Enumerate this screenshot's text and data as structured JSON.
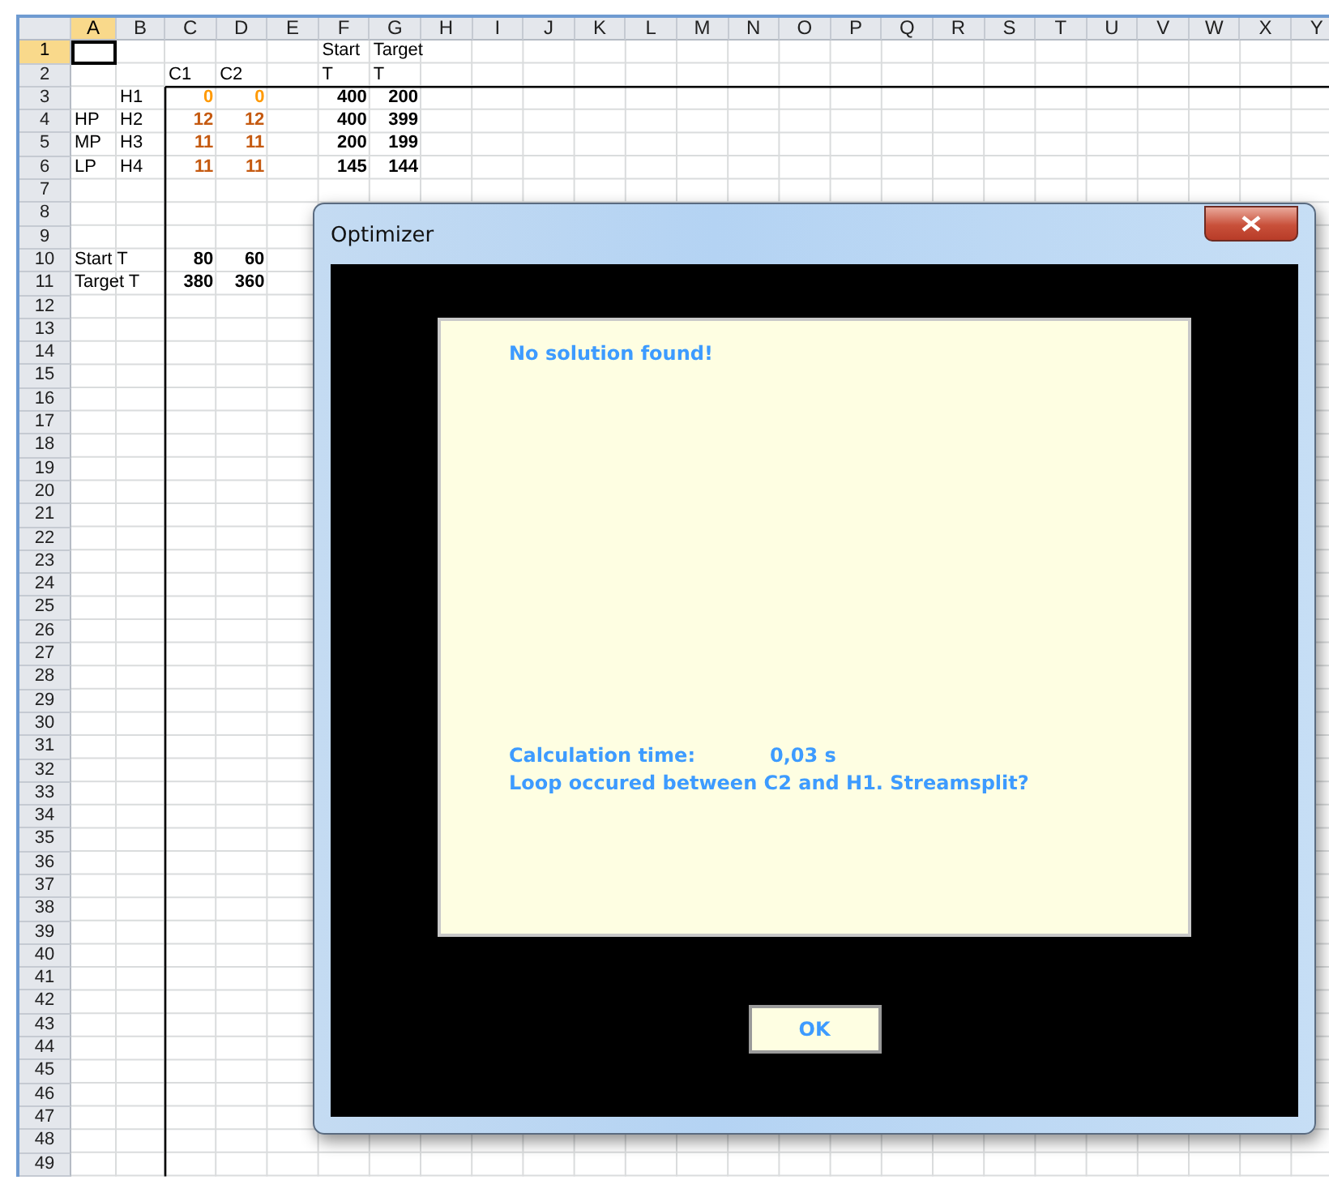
{
  "sheet": {
    "columns": [
      {
        "label": "A",
        "selected": true
      },
      {
        "label": "B",
        "selected": false
      },
      {
        "label": "C",
        "selected": false
      },
      {
        "label": "D",
        "selected": false
      },
      {
        "label": "E",
        "selected": false
      },
      {
        "label": "F",
        "selected": false
      },
      {
        "label": "G",
        "selected": false
      },
      {
        "label": "H",
        "selected": false
      },
      {
        "label": "I",
        "selected": false
      },
      {
        "label": "J",
        "selected": false
      },
      {
        "label": "K",
        "selected": false
      },
      {
        "label": "L",
        "selected": false
      },
      {
        "label": "M",
        "selected": false
      },
      {
        "label": "N",
        "selected": false
      },
      {
        "label": "O",
        "selected": false
      },
      {
        "label": "P",
        "selected": false
      },
      {
        "label": "Q",
        "selected": false
      },
      {
        "label": "R",
        "selected": false
      },
      {
        "label": "S",
        "selected": false
      },
      {
        "label": "T",
        "selected": false
      },
      {
        "label": "U",
        "selected": false
      },
      {
        "label": "V",
        "selected": false
      },
      {
        "label": "W",
        "selected": false
      },
      {
        "label": "X",
        "selected": false
      },
      {
        "label": "Y",
        "selected": false
      }
    ],
    "rows": [
      {
        "label": "1",
        "selected": true,
        "cells": [
          null,
          null,
          null,
          null,
          null,
          {
            "kind": "text",
            "text": "Start"
          },
          {
            "kind": "text",
            "text": "Target"
          }
        ]
      },
      {
        "label": "2",
        "selected": false,
        "cells": [
          null,
          null,
          {
            "kind": "text",
            "text": "C1"
          },
          {
            "kind": "text",
            "text": "C2"
          },
          null,
          {
            "kind": "text",
            "text": "T"
          },
          {
            "kind": "text",
            "text": "T"
          }
        ]
      },
      {
        "label": "3",
        "selected": false,
        "cells": [
          null,
          {
            "kind": "text",
            "text": "H1"
          },
          {
            "kind": "number",
            "text": "0",
            "color": "#ff9900"
          },
          {
            "kind": "number",
            "text": "0",
            "color": "#ff9900"
          },
          null,
          {
            "kind": "number",
            "text": "400",
            "color": "#000000"
          },
          {
            "kind": "number",
            "text": "200",
            "color": "#000000"
          }
        ]
      },
      {
        "label": "4",
        "selected": false,
        "cells": [
          {
            "kind": "text",
            "text": "HP"
          },
          {
            "kind": "text",
            "text": "H2"
          },
          {
            "kind": "number",
            "text": "12",
            "color": "#c55a11"
          },
          {
            "kind": "number",
            "text": "12",
            "color": "#c55a11"
          },
          null,
          {
            "kind": "number",
            "text": "400",
            "color": "#000000"
          },
          {
            "kind": "number",
            "text": "399",
            "color": "#000000"
          }
        ]
      },
      {
        "label": "5",
        "selected": false,
        "cells": [
          {
            "kind": "text",
            "text": "MP"
          },
          {
            "kind": "text",
            "text": "H3"
          },
          {
            "kind": "number",
            "text": "11",
            "color": "#c55a11"
          },
          {
            "kind": "number",
            "text": "11",
            "color": "#c55a11"
          },
          null,
          {
            "kind": "number",
            "text": "200",
            "color": "#000000"
          },
          {
            "kind": "number",
            "text": "199",
            "color": "#000000"
          }
        ]
      },
      {
        "label": "6",
        "selected": false,
        "cells": [
          {
            "kind": "text",
            "text": "LP"
          },
          {
            "kind": "text",
            "text": "H4"
          },
          {
            "kind": "number",
            "text": "11",
            "color": "#c55a11"
          },
          {
            "kind": "number",
            "text": "11",
            "color": "#c55a11"
          },
          null,
          {
            "kind": "number",
            "text": "145",
            "color": "#000000"
          },
          {
            "kind": "number",
            "text": "144",
            "color": "#000000"
          }
        ]
      },
      {
        "label": "7",
        "selected": false
      },
      {
        "label": "8",
        "selected": false
      },
      {
        "label": "9",
        "selected": false
      },
      {
        "label": "10",
        "selected": false,
        "cells": [
          {
            "kind": "text",
            "text": "Start T"
          },
          null,
          {
            "kind": "number",
            "text": "80",
            "color": "#000000"
          },
          {
            "kind": "number",
            "text": "60",
            "color": "#000000"
          }
        ]
      },
      {
        "label": "11",
        "selected": false,
        "cells": [
          {
            "kind": "text",
            "text": "Target T"
          },
          null,
          {
            "kind": "number",
            "text": "380",
            "color": "#000000"
          },
          {
            "kind": "number",
            "text": "360",
            "color": "#000000"
          }
        ]
      },
      {
        "label": "12",
        "selected": false
      },
      {
        "label": "13",
        "selected": false
      },
      {
        "label": "14",
        "selected": false
      },
      {
        "label": "15",
        "selected": false
      },
      {
        "label": "16",
        "selected": false
      },
      {
        "label": "17",
        "selected": false
      },
      {
        "label": "18",
        "selected": false
      },
      {
        "label": "19",
        "selected": false
      },
      {
        "label": "20",
        "selected": false
      },
      {
        "label": "21",
        "selected": false
      },
      {
        "label": "22",
        "selected": false
      },
      {
        "label": "23",
        "selected": false
      },
      {
        "label": "24",
        "selected": false
      },
      {
        "label": "25",
        "selected": false
      },
      {
        "label": "26",
        "selected": false
      },
      {
        "label": "27",
        "selected": false
      },
      {
        "label": "28",
        "selected": false
      },
      {
        "label": "29",
        "selected": false
      },
      {
        "label": "30",
        "selected": false
      },
      {
        "label": "31",
        "selected": false
      },
      {
        "label": "32",
        "selected": false
      },
      {
        "label": "33",
        "selected": false
      },
      {
        "label": "34",
        "selected": false
      },
      {
        "label": "35",
        "selected": false
      },
      {
        "label": "36",
        "selected": false
      },
      {
        "label": "37",
        "selected": false
      },
      {
        "label": "38",
        "selected": false
      },
      {
        "label": "39",
        "selected": false
      },
      {
        "label": "40",
        "selected": false
      },
      {
        "label": "41",
        "selected": false
      },
      {
        "label": "42",
        "selected": false
      },
      {
        "label": "43",
        "selected": false
      },
      {
        "label": "44",
        "selected": false
      },
      {
        "label": "45",
        "selected": false
      },
      {
        "label": "46",
        "selected": false
      },
      {
        "label": "47",
        "selected": false
      },
      {
        "label": "48",
        "selected": false
      },
      {
        "label": "49",
        "selected": false
      }
    ]
  },
  "dialog": {
    "title": "Optimizer",
    "message": "No solution found!",
    "time_label": "Calculation time:",
    "time_value": "0,03 s",
    "detail": "Loop occured between C2 and H1. Streamsplit?",
    "button": "OK"
  }
}
